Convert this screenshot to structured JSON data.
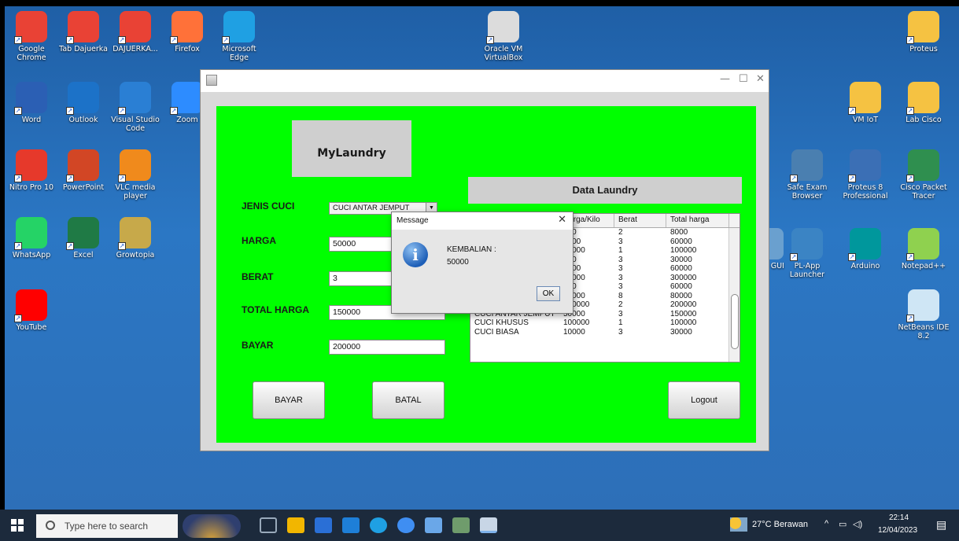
{
  "desktop": {
    "icons": [
      {
        "label": "Google Chrome",
        "icon": "chrome-icon",
        "color": "#e94235"
      },
      {
        "label": "Tab Dajuerka",
        "icon": "chrome-icon",
        "color": "#e94235"
      },
      {
        "label": "DAJUERKA...",
        "icon": "chrome-icon",
        "color": "#e94235"
      },
      {
        "label": "Firefox",
        "icon": "firefox-icon",
        "color": "#ff7139"
      },
      {
        "label": "Microsoft Edge",
        "icon": "edge-icon",
        "color": "#1fa0e3"
      },
      {
        "label": "Oracle VM VirtualBox",
        "icon": "virtualbox-icon",
        "color": "#dcdcdc"
      },
      {
        "label": "Proteus",
        "icon": "folder-icon",
        "color": "#f5c242"
      },
      {
        "label": "Word",
        "icon": "word-icon",
        "color": "#2b5fb4"
      },
      {
        "label": "Outlook",
        "icon": "outlook-icon",
        "color": "#1c72c8"
      },
      {
        "label": "Visual Studio Code",
        "icon": "vscode-icon",
        "color": "#2a7fd4"
      },
      {
        "label": "Zoom",
        "icon": "zoom-icon",
        "color": "#2d8cff"
      },
      {
        "label": "VM IoT",
        "icon": "folder-icon",
        "color": "#f5c242"
      },
      {
        "label": "Lab Cisco",
        "icon": "folder-icon",
        "color": "#f5c242"
      },
      {
        "label": "Nitro Pro 10",
        "icon": "nitro-icon",
        "color": "#e6392b"
      },
      {
        "label": "PowerPoint",
        "icon": "powerpoint-icon",
        "color": "#d24625"
      },
      {
        "label": "VLC media player",
        "icon": "vlc-icon",
        "color": "#f08a1c"
      },
      {
        "label": "Safe Exam Browser",
        "icon": "seb-icon",
        "color": "#4a7fb0"
      },
      {
        "label": "Proteus 8 Professional",
        "icon": "proteus-icon",
        "color": "#3b6fb5"
      },
      {
        "label": "Cisco Packet Tracer",
        "icon": "packet-tracer-icon",
        "color": "#2f8f4f"
      },
      {
        "label": "WhatsApp",
        "icon": "whatsapp-icon",
        "color": "#25d366"
      },
      {
        "label": "Excel",
        "icon": "excel-icon",
        "color": "#1f7a45"
      },
      {
        "label": "Growtopia",
        "icon": "growtopia-icon",
        "color": "#c7a94a"
      },
      {
        "label": "p -\np GUI",
        "icon": "partial-icon",
        "color": "#6aa0cf"
      },
      {
        "label": "PL-App Launcher",
        "icon": "cisco-icon",
        "color": "#3b84c4"
      },
      {
        "label": "Arduino",
        "icon": "arduino-icon",
        "color": "#00979c"
      },
      {
        "label": "Notepad++",
        "icon": "notepadpp-icon",
        "color": "#8fd14f"
      },
      {
        "label": "YouTube",
        "icon": "youtube-icon",
        "color": "#ff0000"
      },
      {
        "label": "NetBeans IDE 8.2",
        "icon": "netbeans-icon",
        "color": "#cfe6f5"
      }
    ]
  },
  "window": {
    "brand": "MyLaundry",
    "form": {
      "jenis_label": "JENIS CUCI",
      "jenis_value": "CUCI ANTAR JEMPUT",
      "harga_label": "HARGA",
      "harga_value": "50000",
      "berat_label": "BERAT",
      "berat_value": "3",
      "total_label": "TOTAL HARGA",
      "total_value": "150000",
      "bayar_label": "BAYAR",
      "bayar_value": "200000"
    },
    "data_title": "Data Laundry",
    "table": {
      "headers": [
        "",
        "Harga/Kilo",
        "Berat",
        "Total harga"
      ],
      "rows": [
        [
          "",
          "000",
          "2",
          "8000"
        ],
        [
          "",
          "0000",
          "3",
          "60000"
        ],
        [
          "",
          "00000",
          "1",
          "100000"
        ],
        [
          "",
          "000",
          "3",
          "30000"
        ],
        [
          "",
          "0000",
          "3",
          "60000"
        ],
        [
          "",
          "00000",
          "3",
          "300000"
        ],
        [
          "",
          "000",
          "3",
          "60000"
        ],
        [
          "CUCI BIASA",
          "10000",
          "8",
          "80000"
        ],
        [
          "CUCI KHUSUS",
          "100000",
          "2",
          "200000"
        ],
        [
          "CUCI ANTAR JEMPUT",
          "50000",
          "3",
          "150000"
        ],
        [
          "CUCI KHUSUS",
          "100000",
          "1",
          "100000"
        ],
        [
          "CUCI BIASA",
          "10000",
          "3",
          "30000"
        ]
      ]
    },
    "buttons": {
      "bayar": "BAYAR",
      "batal": "BATAL",
      "logout": "Logout"
    }
  },
  "dialog": {
    "title": "Message",
    "line1": "KEMBALIAN :",
    "line2": "50000",
    "ok": "OK"
  },
  "taskbar": {
    "search_placeholder": "Type here to search",
    "weather": "27°C Berawan",
    "time": "22:14",
    "date": "12/04/2023"
  }
}
